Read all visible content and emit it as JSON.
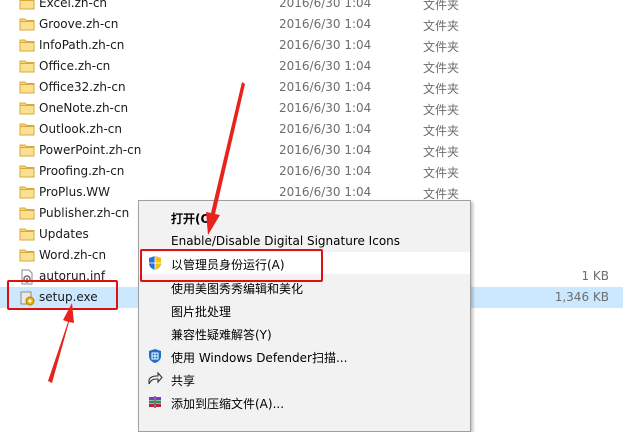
{
  "files": [
    {
      "name": "Excel.zh-cn",
      "date": "2016/6/30 1:04",
      "type": "文件夹",
      "size": "",
      "icon": "folder-icon"
    },
    {
      "name": "Groove.zh-cn",
      "date": "2016/6/30 1:04",
      "type": "文件夹",
      "size": "",
      "icon": "folder-icon"
    },
    {
      "name": "InfoPath.zh-cn",
      "date": "2016/6/30 1:04",
      "type": "文件夹",
      "size": "",
      "icon": "folder-icon"
    },
    {
      "name": "Office.zh-cn",
      "date": "2016/6/30 1:04",
      "type": "文件夹",
      "size": "",
      "icon": "folder-icon"
    },
    {
      "name": "Office32.zh-cn",
      "date": "2016/6/30 1:04",
      "type": "文件夹",
      "size": "",
      "icon": "folder-icon"
    },
    {
      "name": "OneNote.zh-cn",
      "date": "2016/6/30 1:04",
      "type": "文件夹",
      "size": "",
      "icon": "folder-icon"
    },
    {
      "name": "Outlook.zh-cn",
      "date": "2016/6/30 1:04",
      "type": "文件夹",
      "size": "",
      "icon": "folder-icon"
    },
    {
      "name": "PowerPoint.zh-cn",
      "date": "2016/6/30 1:04",
      "type": "文件夹",
      "size": "",
      "icon": "folder-icon"
    },
    {
      "name": "Proofing.zh-cn",
      "date": "2016/6/30 1:04",
      "type": "文件夹",
      "size": "",
      "icon": "folder-icon"
    },
    {
      "name": "ProPlus.WW",
      "date": "2016/6/30 1:04",
      "type": "文件夹",
      "size": "",
      "icon": "folder-icon"
    },
    {
      "name": "Publisher.zh-cn",
      "date": "",
      "type": "",
      "size": "",
      "icon": "folder-icon"
    },
    {
      "name": "Updates",
      "date": "",
      "type": "",
      "size": "",
      "icon": "folder-icon"
    },
    {
      "name": "Word.zh-cn",
      "date": "",
      "type": "",
      "size": "",
      "icon": "folder-icon"
    },
    {
      "name": "autorun.inf",
      "date": "",
      "type": "",
      "size": "1 KB",
      "icon": "inf-file-icon"
    },
    {
      "name": "setup.exe",
      "date": "",
      "type": "",
      "size": "1,346 KB",
      "icon": "setup-exe-icon"
    }
  ],
  "context_menu": {
    "items": [
      {
        "label": "打开(O)",
        "icon": "",
        "bold": true
      },
      {
        "label": "Enable/Disable Digital Signature Icons",
        "icon": ""
      },
      {
        "label": "以管理员身份运行(A)",
        "icon": "uac-shield-icon"
      },
      {
        "label": "使用美图秀秀编辑和美化",
        "icon": ""
      },
      {
        "label": "图片批处理",
        "icon": ""
      },
      {
        "label": "兼容性疑难解答(Y)",
        "icon": ""
      },
      {
        "label": "使用 Windows Defender扫描...",
        "icon": "windows-defender-icon"
      },
      {
        "label": "共享",
        "icon": "share-icon"
      },
      {
        "label": "添加到压缩文件(A)...",
        "icon": "winrar-icon"
      }
    ]
  },
  "colors": {
    "selection": "#cce8ff",
    "annotation": "#e01010",
    "folder": "#f8d775"
  }
}
